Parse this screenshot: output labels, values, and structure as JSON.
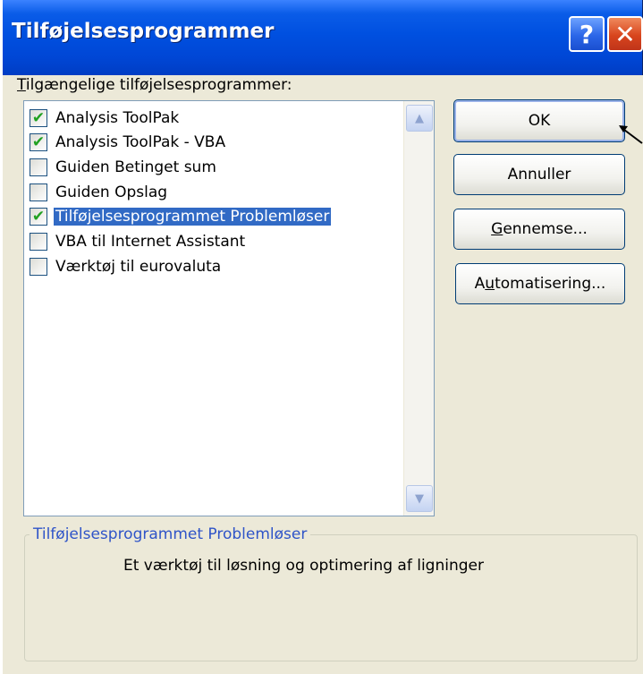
{
  "window": {
    "title": "Tilføjelsesprogrammer",
    "help_glyph": "?",
    "close_glyph": "✕"
  },
  "list": {
    "label_underlined": "T",
    "label_rest": "ilgængelige tilføjelsesprogrammer:",
    "items": [
      {
        "label": "Analysis ToolPak",
        "checked": true,
        "selected": false
      },
      {
        "label": "Analysis ToolPak - VBA",
        "checked": true,
        "selected": false
      },
      {
        "label": "Guiden Betinget sum",
        "checked": false,
        "selected": false
      },
      {
        "label": "Guiden Opslag",
        "checked": false,
        "selected": false
      },
      {
        "label": "Tilføjelsesprogrammet Problemløser",
        "checked": true,
        "selected": true
      },
      {
        "label": "VBA til Internet Assistant",
        "checked": false,
        "selected": false
      },
      {
        "label": "Værktøj til eurovaluta",
        "checked": false,
        "selected": false
      }
    ]
  },
  "buttons": {
    "ok": "OK",
    "cancel": "Annuller",
    "browse_underlined": "G",
    "browse_rest": "ennemse...",
    "automation_prefix": "A",
    "automation_underlined": "u",
    "automation_rest": "tomatisering..."
  },
  "description": {
    "heading": "Tilføjelsesprogrammet Problemløser",
    "text": "Et værktøj til løsning og optimering af ligninger"
  },
  "colors": {
    "titlebar": "#0050e0",
    "selection": "#316ac5",
    "check": "#21a121",
    "group_heading": "#2f54c8"
  }
}
